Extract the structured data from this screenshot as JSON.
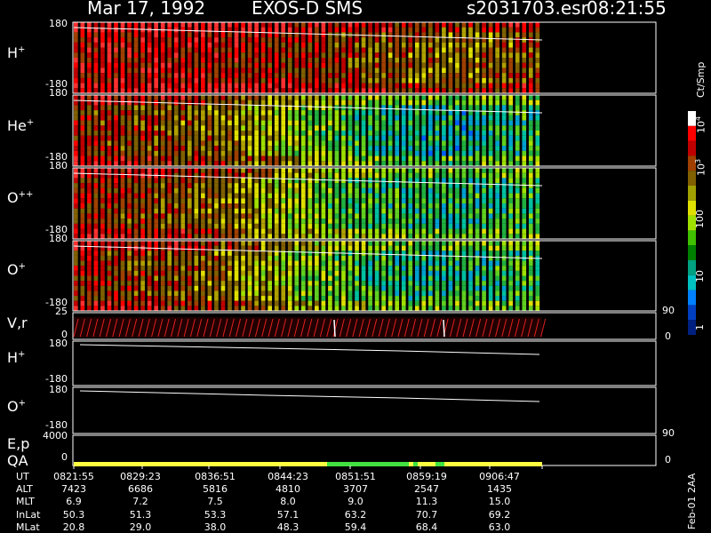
{
  "header": {
    "date": "Mar 17, 1992",
    "instrument": "EXOS-D SMS",
    "file": "s2031703.esr",
    "time": "08:21:55"
  },
  "panels": [
    {
      "id": "H+",
      "label": "H",
      "sup": "+",
      "ytop": "180",
      "ybot": "-180"
    },
    {
      "id": "He+",
      "label": "He",
      "sup": "+",
      "ytop": "180",
      "ybot": "-180"
    },
    {
      "id": "O++",
      "label": "O",
      "sup": "++",
      "ytop": "180",
      "ybot": "-180"
    },
    {
      "id": "O+",
      "label": "O",
      "sup": "+",
      "ytop": "180",
      "ybot": "-180"
    }
  ],
  "vr_panel": {
    "label": "V,r",
    "ytop": "25",
    "ybot": "0",
    "rtop": "90",
    "rbot": "0"
  },
  "line_panels": [
    {
      "id": "H+ line",
      "label": "H",
      "sup": "+",
      "ytop": "180",
      "ybot": "-180"
    },
    {
      "id": "O+ line",
      "label": "O",
      "sup": "+",
      "ytop": "180",
      "ybot": "-180"
    }
  ],
  "ep_panel": {
    "label1": "E,p",
    "label2": "QA",
    "ytop": "4000",
    "ybot": "0",
    "rtop": "90",
    "rbot": "0"
  },
  "colorbar": {
    "unit": "Ct/Smp",
    "ticks": [
      "10",
      "10",
      "100",
      "10",
      "1"
    ],
    "tick_sup": [
      "4",
      "3",
      "",
      "",
      ""
    ],
    "colors": [
      "#ffffff",
      "#ff0000",
      "#c00000",
      "#a04000",
      "#806000",
      "#a0a000",
      "#e0e000",
      "#a0e000",
      "#40c000",
      "#008000",
      "#00a080",
      "#00c0c0",
      "#0080ff",
      "#0040c0",
      "#002080"
    ]
  },
  "axis_table": {
    "labels": [
      "UT",
      "ALT",
      "MLT",
      "InLat",
      "MLat"
    ],
    "columns": [
      [
        "0821:55",
        "7423",
        "6.9",
        "50.3",
        "20.8"
      ],
      [
        "0829:23",
        "6686",
        "7.2",
        "51.3",
        "29.0"
      ],
      [
        "0836:51",
        "5816",
        "7.5",
        "53.3",
        "38.0"
      ],
      [
        "0844:23",
        "4810",
        "8.0",
        "57.1",
        "48.3"
      ],
      [
        "0851:51",
        "3707",
        "9.0",
        "63.2",
        "59.4"
      ],
      [
        "0859:19",
        "2547",
        "11.3",
        "70.7",
        "68.4"
      ],
      [
        "0906:47",
        "1435",
        "15.0",
        "69.2",
        "63.0"
      ]
    ]
  },
  "footnote": "Feb-01 2AA",
  "chart_data": {
    "type": "heatmap",
    "title": "Mar 17, 1992   EXOS-D SMS",
    "x_tick_labels": [
      "0821:55",
      "0829:23",
      "0836:51",
      "0844:23",
      "0851:51",
      "0859:19",
      "0906:47"
    ],
    "y_range_panels": [
      -180,
      180
    ],
    "colorbar_range": [
      1,
      10000
    ],
    "colorbar_scale": "log",
    "series": [
      {
        "name": "H+",
        "intensity_profile": [
          3,
          3,
          3,
          2.8,
          2.5,
          2.3,
          2.6
        ]
      },
      {
        "name": "He+",
        "intensity_profile": [
          2.8,
          2.6,
          2.3,
          1.6,
          1.1,
          1.0,
          1.2
        ]
      },
      {
        "name": "O++",
        "intensity_profile": [
          2.8,
          2.6,
          2.3,
          1.6,
          1.2,
          1.1,
          1.3
        ]
      },
      {
        "name": "O+",
        "intensity_profile": [
          2.8,
          2.6,
          2.3,
          1.6,
          1.2,
          1.1,
          1.3
        ]
      }
    ],
    "qa_bar": [
      {
        "from": "0821:55",
        "to": "0851:00",
        "color": "#ffff40"
      },
      {
        "from": "0851:00",
        "to": "0859:00",
        "color": "#40e040"
      },
      {
        "from": "0859:00",
        "to": "0910:00",
        "color": "#ffff40"
      }
    ]
  }
}
